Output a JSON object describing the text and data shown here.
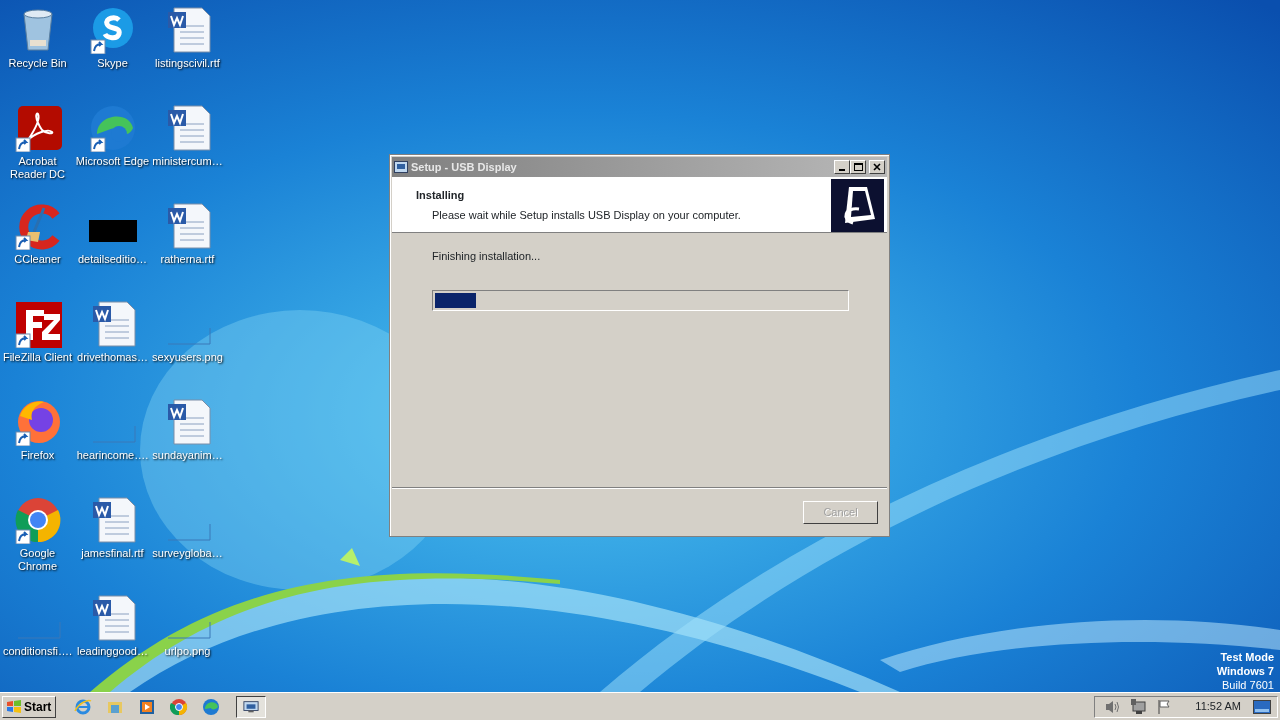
{
  "desktop_icons": [
    {
      "label": "Recycle Bin",
      "kind": "recycle",
      "shortcut": false
    },
    {
      "label": "Acrobat Reader DC",
      "kind": "acrobat",
      "shortcut": true
    },
    {
      "label": "CCleaner",
      "kind": "ccleaner",
      "shortcut": true
    },
    {
      "label": "FileZilla Client",
      "kind": "filezilla",
      "shortcut": true
    },
    {
      "label": "Firefox",
      "kind": "firefox",
      "shortcut": true
    },
    {
      "label": "Google Chrome",
      "kind": "chrome",
      "shortcut": true
    },
    {
      "label": "conditionsfi….",
      "kind": "blank",
      "shortcut": false
    },
    {
      "label": "Skype",
      "kind": "skype",
      "shortcut": true
    },
    {
      "label": "Microsoft Edge",
      "kind": "edge",
      "shortcut": true
    },
    {
      "label": "detailseditio…",
      "kind": "black",
      "shortcut": false
    },
    {
      "label": "drivethomas…",
      "kind": "word",
      "shortcut": false
    },
    {
      "label": "hearincome….",
      "kind": "blank",
      "shortcut": false
    },
    {
      "label": "jamesfinal.rtf",
      "kind": "word",
      "shortcut": false
    },
    {
      "label": "leadinggood…",
      "kind": "word",
      "shortcut": false
    },
    {
      "label": "listingscivil.rtf",
      "kind": "word",
      "shortcut": false
    },
    {
      "label": "ministercum…",
      "kind": "word",
      "shortcut": false
    },
    {
      "label": "ratherna.rtf",
      "kind": "word",
      "shortcut": false
    },
    {
      "label": "sexyusers.png",
      "kind": "blank",
      "shortcut": false
    },
    {
      "label": "sundayanim…",
      "kind": "word",
      "shortcut": false
    },
    {
      "label": "surveygloba…",
      "kind": "blank",
      "shortcut": false
    },
    {
      "label": "urlpo.png",
      "kind": "blank",
      "shortcut": false
    }
  ],
  "window": {
    "title": "Setup - USB Display",
    "heading": "Installing",
    "subheading": "Please wait while Setup installs USB Display on your computer.",
    "status": "Finishing installation...",
    "progress": {
      "level": 0.1
    },
    "buttons": [
      {
        "label": "Cancel",
        "disabled": true
      }
    ]
  },
  "system_info": [
    "Test Mode",
    "Windows 7",
    "Build 7601"
  ],
  "taskbar": {
    "start": "Start",
    "quick_launch": [
      {
        "kind": "ie"
      },
      {
        "kind": "explorer"
      },
      {
        "kind": "media"
      },
      {
        "kind": "chrome"
      },
      {
        "kind": "edge"
      }
    ],
    "tasks": [
      {
        "kind": "setup",
        "active": true
      }
    ],
    "tray": [
      {
        "kind": "volume"
      },
      {
        "kind": "network"
      },
      {
        "kind": "flag"
      }
    ],
    "clock": "11:52 AM"
  }
}
